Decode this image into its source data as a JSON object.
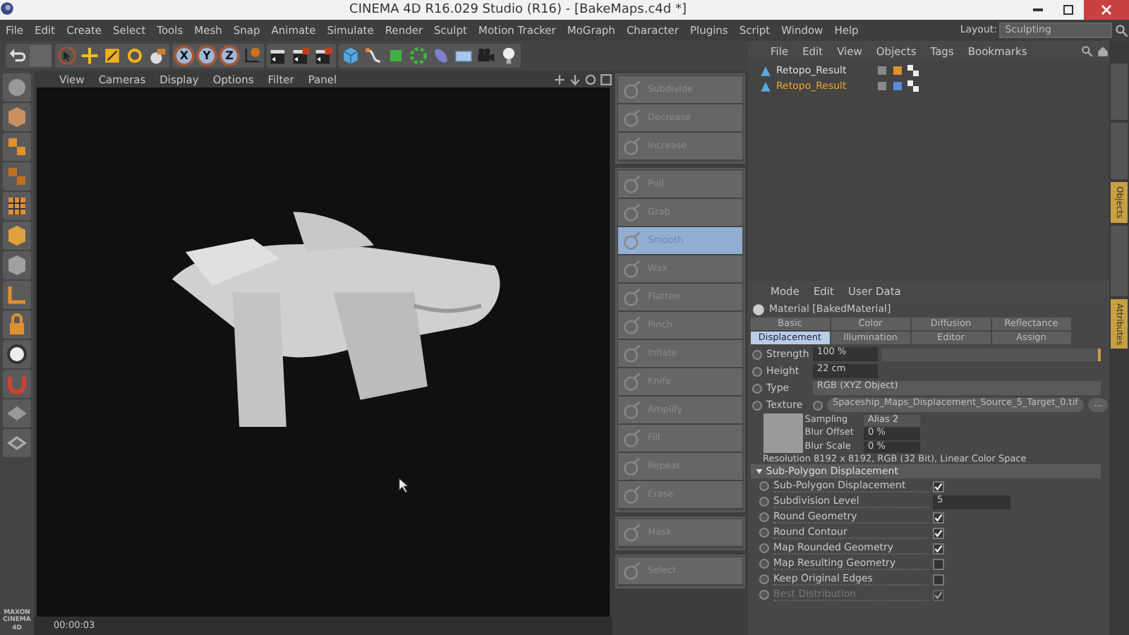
{
  "window": {
    "title": "CINEMA 4D R16.029 Studio (R16) - [BakeMaps.c4d *]"
  },
  "menu_bar": [
    "File",
    "Edit",
    "Create",
    "Select",
    "Tools",
    "Mesh",
    "Snap",
    "Animate",
    "Simulate",
    "Render",
    "Sculpt",
    "Motion Tracker",
    "MoGraph",
    "Character",
    "Plugins",
    "Script",
    "Window",
    "Help"
  ],
  "layout": {
    "label": "Layout:",
    "value": "Sculpting"
  },
  "axis_buttons": [
    {
      "label": "X",
      "on": true
    },
    {
      "label": "Y",
      "on": true
    },
    {
      "label": "Z",
      "on": true
    }
  ],
  "logo": [
    "MAXON",
    "CINEMA 4D"
  ],
  "viewport": {
    "menu": [
      "View",
      "Cameras",
      "Display",
      "Options",
      "Filter",
      "Panel"
    ],
    "timecode": "00:00:03"
  },
  "brush_groups": [
    [
      {
        "label": "Subdivide",
        "selected": false
      },
      {
        "label": "Decrease",
        "selected": false
      },
      {
        "label": "Increase",
        "selected": false
      }
    ],
    [
      {
        "label": "Pull",
        "selected": false
      },
      {
        "label": "Grab",
        "selected": false
      },
      {
        "label": "Smooth",
        "selected": true
      },
      {
        "label": "Wax",
        "selected": false
      },
      {
        "label": "Flatten",
        "selected": false
      },
      {
        "label": "Pinch",
        "selected": false
      },
      {
        "label": "Inflate",
        "selected": false
      },
      {
        "label": "Knife",
        "selected": false
      },
      {
        "label": "Amplify",
        "selected": false
      },
      {
        "label": "Fill",
        "selected": false
      },
      {
        "label": "Repeat",
        "selected": false
      },
      {
        "label": "Erase",
        "selected": false
      }
    ],
    [
      {
        "label": "Mask",
        "selected": false
      }
    ],
    [
      {
        "label": "Select",
        "selected": false
      }
    ]
  ],
  "object_manager": {
    "menu": [
      "File",
      "Edit",
      "View",
      "Objects",
      "Tags",
      "Bookmarks"
    ],
    "objects": [
      {
        "name": "Retopo_Result",
        "selected": false
      },
      {
        "name": "Retopo_Result",
        "selected": true
      }
    ]
  },
  "side_tabs": [
    {
      "label": "Objects",
      "selected": true
    },
    {
      "label": "Attributes",
      "selected": true
    }
  ],
  "attributes": {
    "menu": [
      "Mode",
      "Edit",
      "User Data"
    ],
    "header": "Material [BakedMaterial]",
    "tabs": [
      {
        "label": "Basic",
        "selected": false
      },
      {
        "label": "Color",
        "selected": false
      },
      {
        "label": "Diffusion",
        "selected": false
      },
      {
        "label": "Reflectance",
        "selected": false
      },
      {
        "label": "Displacement",
        "selected": true
      },
      {
        "label": "Illumination",
        "selected": false
      },
      {
        "label": "Editor",
        "selected": false
      },
      {
        "label": "Assign",
        "selected": false
      }
    ],
    "strength": {
      "label": "Strength",
      "value": "100 %",
      "level": 1
    },
    "height": {
      "label": "Height",
      "value": "22 cm"
    },
    "type": {
      "label": "Type",
      "value": "RGB (XYZ Object)"
    },
    "texture": {
      "label": "Texture",
      "file": "Spaceship_Maps_Displacement_Source_5_Target_0.tif",
      "browse": "...",
      "fields": [
        {
          "label": "Sampling",
          "value": "Alias 2",
          "kind": "dropdown"
        },
        {
          "label": "Blur Offset",
          "value": "0 %",
          "kind": "number"
        },
        {
          "label": "Blur Scale",
          "value": "0 %",
          "kind": "number"
        }
      ],
      "info": "Resolution 8192 x 8192, RGB (32 Bit), Linear Color Space"
    },
    "section": {
      "title": "Sub-Polygon Displacement",
      "expanded": true,
      "rows": [
        {
          "kind": "checkbox",
          "label": "Sub-Polygon Displacement",
          "checked": true,
          "disabled": false
        },
        {
          "kind": "number",
          "label": "Subdivision Level",
          "value": "5",
          "disabled": false
        },
        {
          "kind": "checkbox",
          "label": "Round Geometry",
          "checked": true,
          "disabled": false
        },
        {
          "kind": "checkbox",
          "label": "Round Contour",
          "checked": true,
          "disabled": false
        },
        {
          "kind": "checkbox",
          "label": "Map Rounded Geometry",
          "checked": true,
          "disabled": false
        },
        {
          "kind": "checkbox",
          "label": "Map Resulting Geometry",
          "checked": false,
          "disabled": false
        },
        {
          "kind": "checkbox",
          "label": "Keep Original Edges",
          "checked": false,
          "disabled": false
        },
        {
          "kind": "checkbox",
          "label": "Best Distribution",
          "checked": true,
          "disabled": true
        }
      ]
    }
  }
}
